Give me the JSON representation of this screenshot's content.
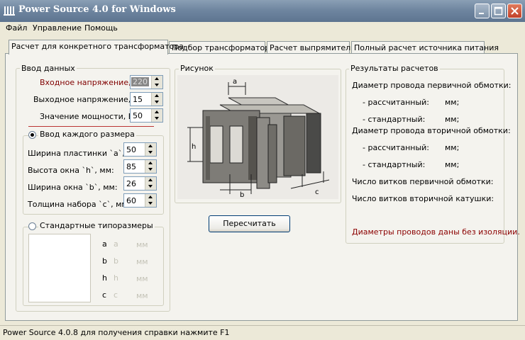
{
  "window": {
    "title": "Power Source 4.0 for Windows",
    "colors": {
      "titlebar": "#6f86a0",
      "close": "#c2412a",
      "panel": "#f4f3ee"
    }
  },
  "menu": {
    "items": [
      "Файл",
      "Управление",
      "Помощь"
    ]
  },
  "tabs": [
    {
      "label": "Расчет для конкретного трансформатора",
      "active": true
    },
    {
      "label": "Подбор трансформатора",
      "active": false
    },
    {
      "label": "Расчет выпрямителя",
      "active": false
    },
    {
      "label": "Полный расчет источника питания",
      "active": false
    }
  ],
  "input_group": {
    "title": "Ввод  данных",
    "fields": [
      {
        "label": "Входное напряжение, В:",
        "value": "220"
      },
      {
        "label": "Выходное напряжение, В:",
        "value": "15"
      },
      {
        "label": "Значение мощности, Вт:",
        "value": "50"
      }
    ]
  },
  "size_group": {
    "radio_label": "Ввод каждого размера",
    "fields": [
      {
        "label": "Ширина пластинки `a`, мм:",
        "value": "50"
      },
      {
        "label": "Высота окна `h`, мм:",
        "value": "85"
      },
      {
        "label": "Ширина окна `b`, мм:",
        "value": "26"
      },
      {
        "label": "Толщина набора `c`, мм:",
        "value": "60"
      }
    ]
  },
  "standard_group": {
    "radio_label": "Стандартные типоразмеры",
    "rows": [
      {
        "letter": "a",
        "value": "a",
        "unit": "мм"
      },
      {
        "letter": "b",
        "value": "b",
        "unit": "мм"
      },
      {
        "letter": "h",
        "value": "h",
        "unit": "мм"
      },
      {
        "letter": "c",
        "value": "c",
        "unit": "мм"
      }
    ]
  },
  "picture": {
    "title": "Рисунок",
    "dim_labels": {
      "a": "a",
      "h": "h",
      "b": "b",
      "c": "c"
    }
  },
  "recalc_button": "Пересчитать",
  "results": {
    "title": "Результаты расчетов",
    "primary_header": "Диаметр провода первичной обмотки:",
    "primary_calc_label": "- рассчитанный:",
    "primary_calc_unit": "мм;",
    "primary_std_label": "- стандартный:",
    "primary_std_unit": "мм;",
    "secondary_header": "Диаметр провода вторичной обмотки:",
    "secondary_calc_label": "- рассчитанный:",
    "secondary_calc_unit": "мм;",
    "secondary_std_label": "- стандартный:",
    "secondary_std_unit": "мм;",
    "turns_primary": "Число витков первичной обмотки:",
    "turns_secondary": "Число витков вторичной катушки:",
    "note": "Диаметры проводов даны без изоляции."
  },
  "status": {
    "text": "Power Source 4.0.8 для получения справки нажмите F1"
  }
}
